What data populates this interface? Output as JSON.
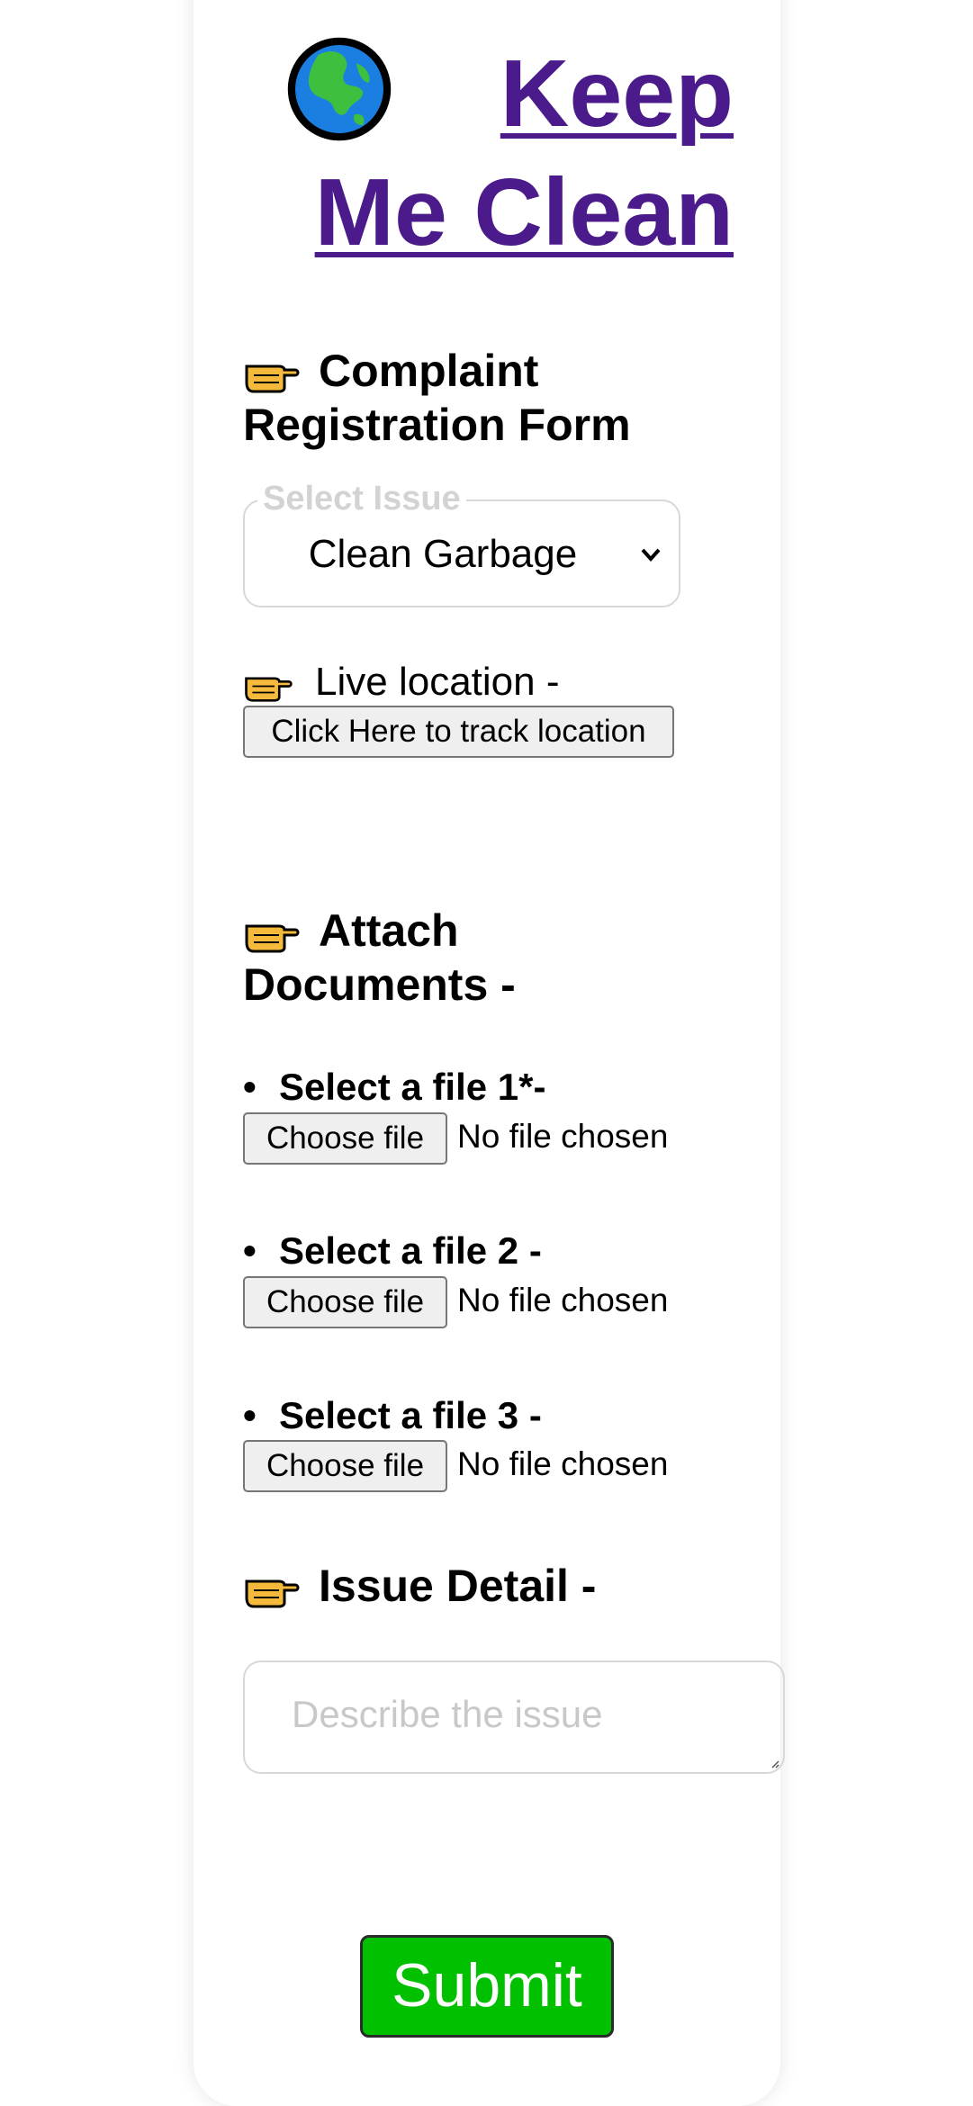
{
  "header": {
    "title_line1": "Keep",
    "title_line2": "Me Clean",
    "title_color": "#4b1a8b"
  },
  "complaint": {
    "heading_line1": "Complaint",
    "heading_line2": "Registration Form",
    "select_legend": "Select Issue",
    "select_value": "Clean Garbage"
  },
  "location": {
    "label": "Live location -",
    "button": "Click Here to track location"
  },
  "attach": {
    "heading_line1": "Attach",
    "heading_line2": "Documents -",
    "files": [
      {
        "label": "Select a file 1*-",
        "button": "Choose file",
        "status": "No file chosen"
      },
      {
        "label": "Select a file 2 -",
        "button": "Choose file",
        "status": "No file chosen"
      },
      {
        "label": "Select a file 3 -",
        "button": "Choose file",
        "status": "No file chosen"
      }
    ]
  },
  "issue": {
    "heading": "Issue Detail -",
    "placeholder": "Describe the issue"
  },
  "submit": {
    "label": "Submit",
    "color": "#00c000"
  },
  "icons": {
    "globe": "globe-asia-icon",
    "pointer": "pointing-hand-icon"
  }
}
